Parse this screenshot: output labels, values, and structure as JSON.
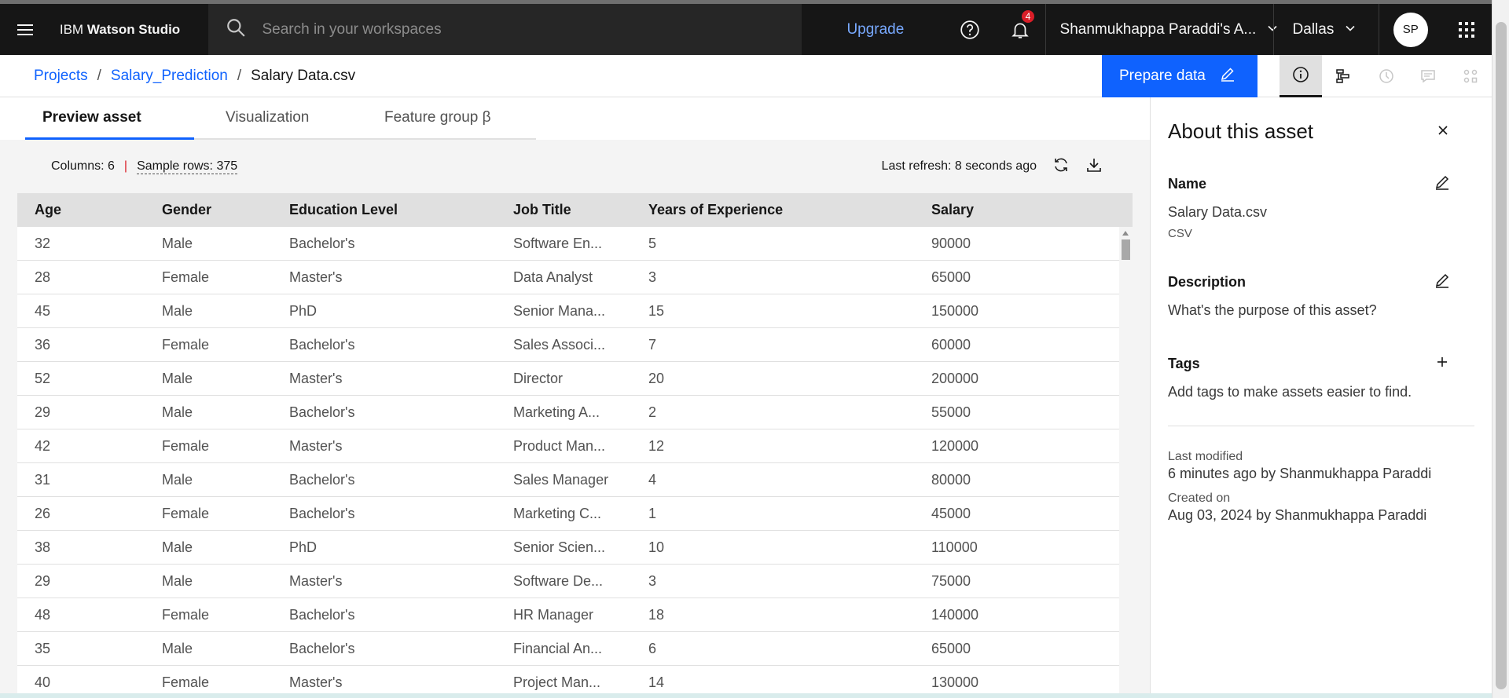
{
  "header": {
    "brand_prefix": "IBM ",
    "brand_name": "Watson Studio",
    "search_placeholder": "Search in your workspaces",
    "upgrade_label": "Upgrade",
    "notification_count": "4",
    "account_name": "Shanmukhappa Paraddi's A...",
    "region": "Dallas",
    "avatar_initials": "SP"
  },
  "breadcrumb": {
    "items": [
      "Projects",
      "Salary_Prediction"
    ],
    "current": "Salary Data.csv",
    "separator": "/"
  },
  "toolbar": {
    "prepare_label": "Prepare data"
  },
  "tabs": [
    "Preview asset",
    "Visualization",
    "Feature group β"
  ],
  "meta": {
    "columns_label": "Columns: 6",
    "pipe": "|",
    "sample_rows_label": "Sample rows: 375",
    "last_refresh": "Last refresh: 8 seconds ago"
  },
  "table": {
    "columns": [
      "Age",
      "Gender",
      "Education Level",
      "Job Title",
      "Years of Experience",
      "Salary"
    ],
    "rows": [
      [
        "32",
        "Male",
        "Bachelor's",
        "Software En...",
        "5",
        "90000"
      ],
      [
        "28",
        "Female",
        "Master's",
        "Data Analyst",
        "3",
        "65000"
      ],
      [
        "45",
        "Male",
        "PhD",
        "Senior Mana...",
        "15",
        "150000"
      ],
      [
        "36",
        "Female",
        "Bachelor's",
        "Sales Associ...",
        "7",
        "60000"
      ],
      [
        "52",
        "Male",
        "Master's",
        "Director",
        "20",
        "200000"
      ],
      [
        "29",
        "Male",
        "Bachelor's",
        "Marketing A...",
        "2",
        "55000"
      ],
      [
        "42",
        "Female",
        "Master's",
        "Product Man...",
        "12",
        "120000"
      ],
      [
        "31",
        "Male",
        "Bachelor's",
        "Sales Manager",
        "4",
        "80000"
      ],
      [
        "26",
        "Female",
        "Bachelor's",
        "Marketing C...",
        "1",
        "45000"
      ],
      [
        "38",
        "Male",
        "PhD",
        "Senior Scien...",
        "10",
        "110000"
      ],
      [
        "29",
        "Male",
        "Master's",
        "Software De...",
        "3",
        "75000"
      ],
      [
        "48",
        "Female",
        "Bachelor's",
        "HR Manager",
        "18",
        "140000"
      ],
      [
        "35",
        "Male",
        "Bachelor's",
        "Financial An...",
        "6",
        "65000"
      ],
      [
        "40",
        "Female",
        "Master's",
        "Project Man...",
        "14",
        "130000"
      ]
    ]
  },
  "panel": {
    "title": "About this asset",
    "name_label": "Name",
    "name_value": "Salary Data.csv",
    "name_type": "CSV",
    "description_label": "Description",
    "description_value": "What's the purpose of this asset?",
    "tags_label": "Tags",
    "tags_value": "Add tags to make assets easier to find.",
    "last_modified_label": "Last modified",
    "last_modified_value": "6 minutes ago by Shanmukhappa Paraddi",
    "created_label": "Created on",
    "created_value": "Aug 03, 2024 by Shanmukhappa Paraddi"
  },
  "colors": {
    "header_bg": "#161616",
    "accent_blue": "#0f62fe",
    "link_blue": "#78a9ff",
    "badge_red": "#da1e28"
  }
}
